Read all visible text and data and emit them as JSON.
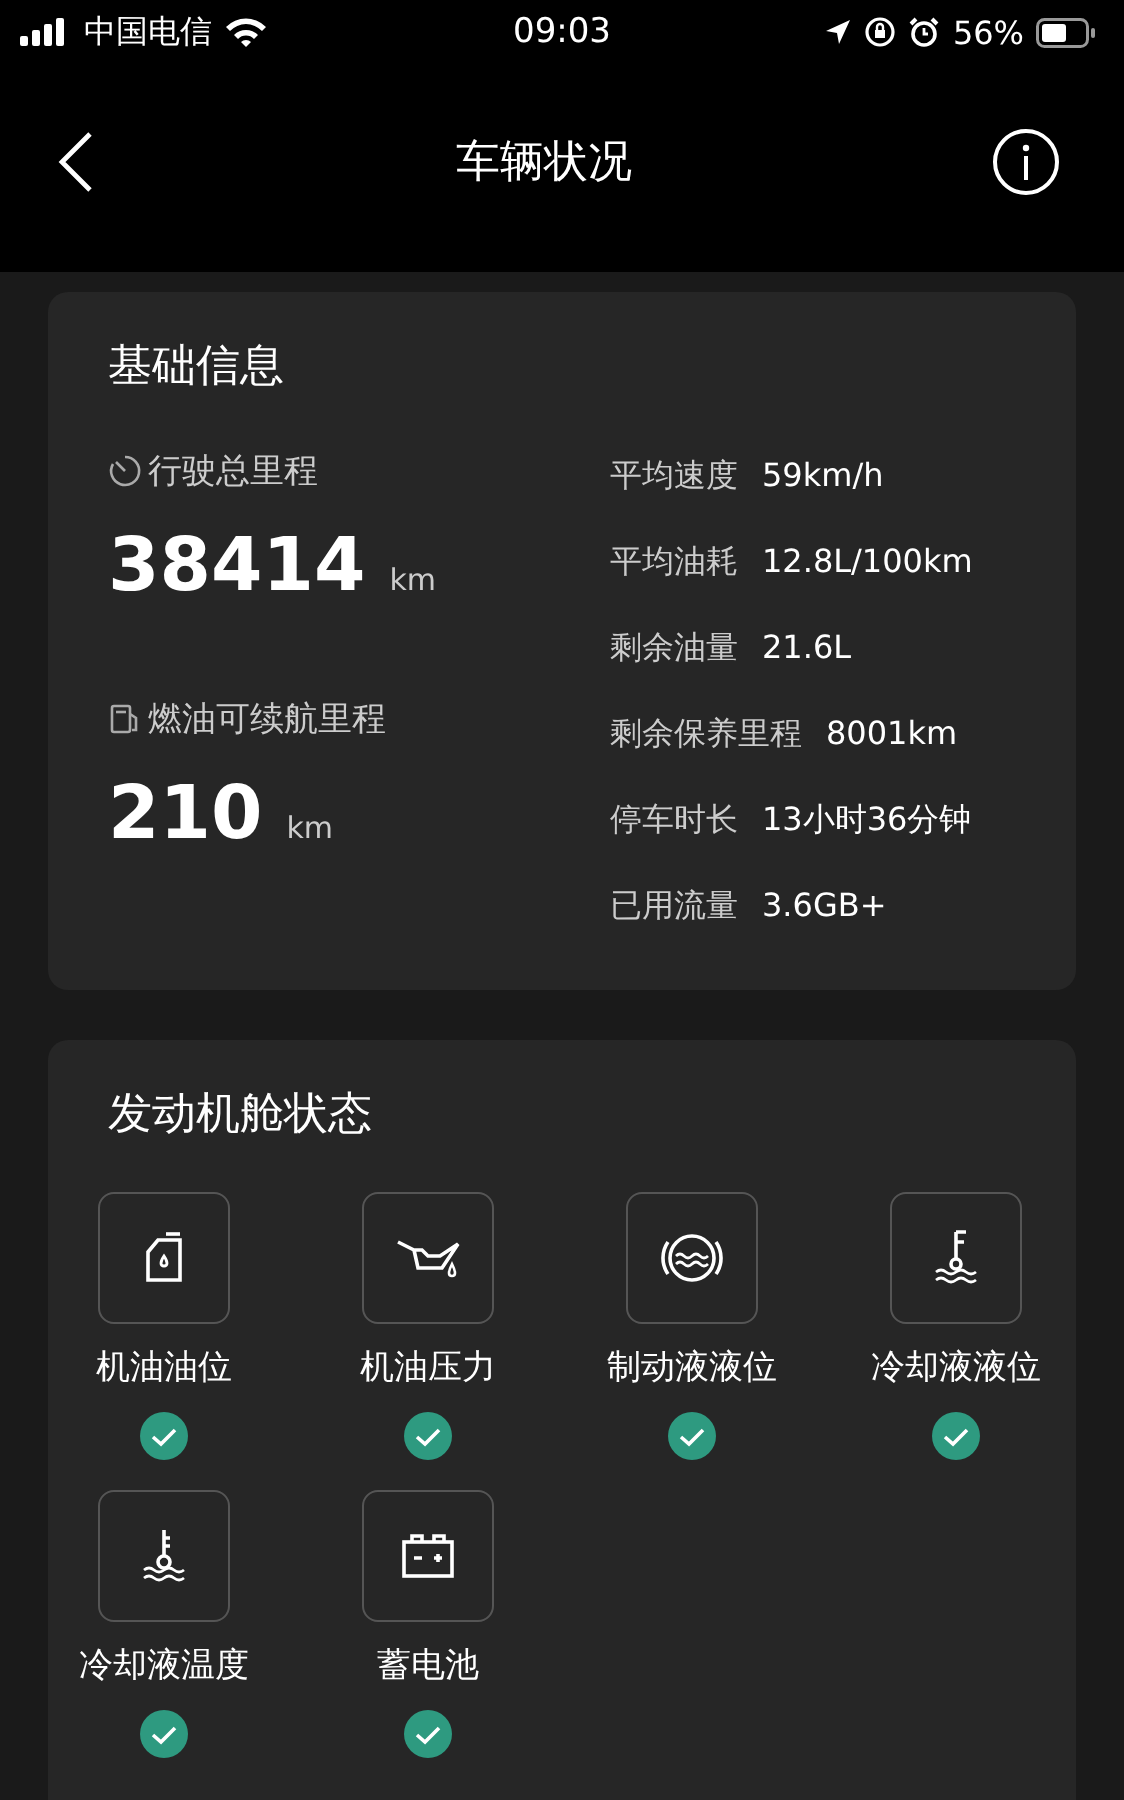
{
  "status_bar": {
    "carrier": "中国电信",
    "time": "09:03",
    "battery": "56%"
  },
  "nav": {
    "title": "车辆状况"
  },
  "basic_info": {
    "title": "基础信息",
    "odometer": {
      "label": "行驶总里程",
      "value": "38414",
      "unit": "km"
    },
    "range": {
      "label": "燃油可续航里程",
      "value": "210",
      "unit": "km"
    },
    "stats": [
      {
        "label": "平均速度",
        "value": "59km/h"
      },
      {
        "label": "平均油耗",
        "value": "12.8L/100km"
      },
      {
        "label": "剩余油量",
        "value": "21.6L"
      },
      {
        "label": "剩余保养里程",
        "value": "8001km"
      },
      {
        "label": "停车时长",
        "value": "13小时36分钟"
      },
      {
        "label": "已用流量",
        "value": "3.6GB+"
      }
    ]
  },
  "engine_status": {
    "title": "发动机舱状态",
    "items": [
      {
        "kind": "oil-level",
        "label": "机油油位",
        "ok": true
      },
      {
        "kind": "oil-pressure",
        "label": "机油压力",
        "ok": true
      },
      {
        "kind": "brake-fluid",
        "label": "制动液液位",
        "ok": true
      },
      {
        "kind": "coolant-level",
        "label": "冷却液液位",
        "ok": true
      },
      {
        "kind": "coolant-temp",
        "label": "冷却液温度",
        "ok": true
      },
      {
        "kind": "battery",
        "label": "蓄电池",
        "ok": true
      }
    ]
  }
}
